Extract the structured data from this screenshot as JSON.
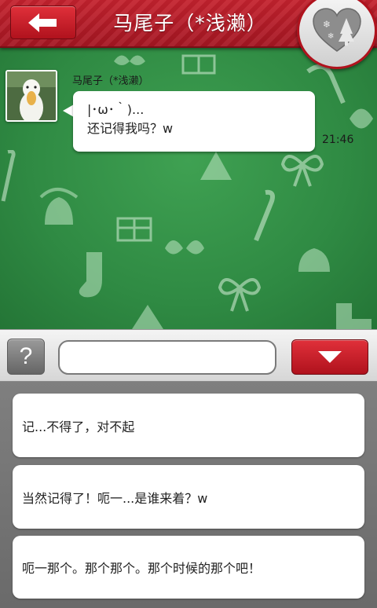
{
  "header": {
    "title": "马尾子（*浅濑）",
    "back_icon": "arrow-left-icon",
    "badge_icon": "christmas-heart-icon"
  },
  "conversation": {
    "sender_name": "马尾子（*浅濑）",
    "message_lines": [
      "|･ω･｀)...",
      "还记得我吗？w"
    ],
    "time": "21:46"
  },
  "input_bar": {
    "help_label": "?",
    "input_value": "",
    "input_placeholder": "",
    "toggle_icon": "triangle-down-icon"
  },
  "reply_options": [
    "记...不得了，对不起",
    "当然记得了！呃一...是谁来着？w",
    "呃一那个。那个那个。那个时候的那个吧！"
  ],
  "colors": {
    "header_red": "#b0121d",
    "chat_green": "#2f8a43",
    "options_gray": "#777777"
  }
}
